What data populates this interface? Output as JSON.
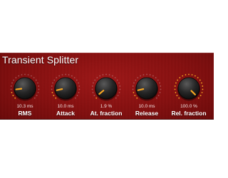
{
  "plugin": {
    "title": "Transient Splitter",
    "accent_color": "#f6a623",
    "knobs": [
      {
        "label": "RMS",
        "value": "10.3 ms",
        "level": 0.14
      },
      {
        "label": "Attack",
        "value": "10.0 ms",
        "level": 0.12
      },
      {
        "label": "At. fraction",
        "value": "1.9 %",
        "level": 0.02
      },
      {
        "label": "Release",
        "value": "10.0 ms",
        "level": 0.12
      },
      {
        "label": "Rel. fraction",
        "value": "100.0 %",
        "level": 1.0
      }
    ]
  }
}
